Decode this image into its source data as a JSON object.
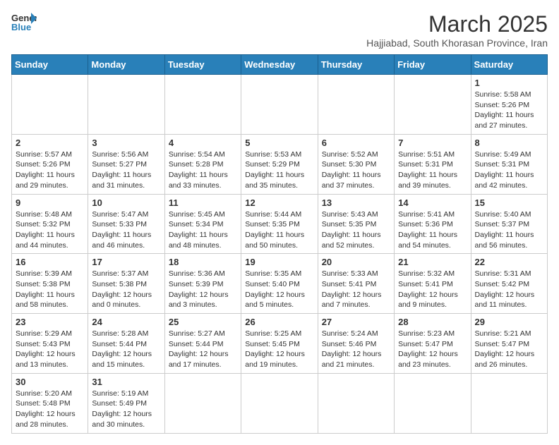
{
  "logo": {
    "text_general": "General",
    "text_blue": "Blue"
  },
  "title": "March 2025",
  "location": "Hajjiabad, South Khorasan Province, Iran",
  "days_of_week": [
    "Sunday",
    "Monday",
    "Tuesday",
    "Wednesday",
    "Thursday",
    "Friday",
    "Saturday"
  ],
  "weeks": [
    [
      {
        "day": "",
        "info": ""
      },
      {
        "day": "",
        "info": ""
      },
      {
        "day": "",
        "info": ""
      },
      {
        "day": "",
        "info": ""
      },
      {
        "day": "",
        "info": ""
      },
      {
        "day": "",
        "info": ""
      },
      {
        "day": "1",
        "info": "Sunrise: 5:58 AM\nSunset: 5:26 PM\nDaylight: 11 hours and 27 minutes."
      }
    ],
    [
      {
        "day": "2",
        "info": "Sunrise: 5:57 AM\nSunset: 5:26 PM\nDaylight: 11 hours and 29 minutes."
      },
      {
        "day": "3",
        "info": "Sunrise: 5:56 AM\nSunset: 5:27 PM\nDaylight: 11 hours and 31 minutes."
      },
      {
        "day": "4",
        "info": "Sunrise: 5:54 AM\nSunset: 5:28 PM\nDaylight: 11 hours and 33 minutes."
      },
      {
        "day": "5",
        "info": "Sunrise: 5:53 AM\nSunset: 5:29 PM\nDaylight: 11 hours and 35 minutes."
      },
      {
        "day": "6",
        "info": "Sunrise: 5:52 AM\nSunset: 5:30 PM\nDaylight: 11 hours and 37 minutes."
      },
      {
        "day": "7",
        "info": "Sunrise: 5:51 AM\nSunset: 5:31 PM\nDaylight: 11 hours and 39 minutes."
      },
      {
        "day": "8",
        "info": "Sunrise: 5:49 AM\nSunset: 5:31 PM\nDaylight: 11 hours and 42 minutes."
      }
    ],
    [
      {
        "day": "9",
        "info": "Sunrise: 5:48 AM\nSunset: 5:32 PM\nDaylight: 11 hours and 44 minutes."
      },
      {
        "day": "10",
        "info": "Sunrise: 5:47 AM\nSunset: 5:33 PM\nDaylight: 11 hours and 46 minutes."
      },
      {
        "day": "11",
        "info": "Sunrise: 5:45 AM\nSunset: 5:34 PM\nDaylight: 11 hours and 48 minutes."
      },
      {
        "day": "12",
        "info": "Sunrise: 5:44 AM\nSunset: 5:35 PM\nDaylight: 11 hours and 50 minutes."
      },
      {
        "day": "13",
        "info": "Sunrise: 5:43 AM\nSunset: 5:35 PM\nDaylight: 11 hours and 52 minutes."
      },
      {
        "day": "14",
        "info": "Sunrise: 5:41 AM\nSunset: 5:36 PM\nDaylight: 11 hours and 54 minutes."
      },
      {
        "day": "15",
        "info": "Sunrise: 5:40 AM\nSunset: 5:37 PM\nDaylight: 11 hours and 56 minutes."
      }
    ],
    [
      {
        "day": "16",
        "info": "Sunrise: 5:39 AM\nSunset: 5:38 PM\nDaylight: 11 hours and 58 minutes."
      },
      {
        "day": "17",
        "info": "Sunrise: 5:37 AM\nSunset: 5:38 PM\nDaylight: 12 hours and 0 minutes."
      },
      {
        "day": "18",
        "info": "Sunrise: 5:36 AM\nSunset: 5:39 PM\nDaylight: 12 hours and 3 minutes."
      },
      {
        "day": "19",
        "info": "Sunrise: 5:35 AM\nSunset: 5:40 PM\nDaylight: 12 hours and 5 minutes."
      },
      {
        "day": "20",
        "info": "Sunrise: 5:33 AM\nSunset: 5:41 PM\nDaylight: 12 hours and 7 minutes."
      },
      {
        "day": "21",
        "info": "Sunrise: 5:32 AM\nSunset: 5:41 PM\nDaylight: 12 hours and 9 minutes."
      },
      {
        "day": "22",
        "info": "Sunrise: 5:31 AM\nSunset: 5:42 PM\nDaylight: 12 hours and 11 minutes."
      }
    ],
    [
      {
        "day": "23",
        "info": "Sunrise: 5:29 AM\nSunset: 5:43 PM\nDaylight: 12 hours and 13 minutes."
      },
      {
        "day": "24",
        "info": "Sunrise: 5:28 AM\nSunset: 5:44 PM\nDaylight: 12 hours and 15 minutes."
      },
      {
        "day": "25",
        "info": "Sunrise: 5:27 AM\nSunset: 5:44 PM\nDaylight: 12 hours and 17 minutes."
      },
      {
        "day": "26",
        "info": "Sunrise: 5:25 AM\nSunset: 5:45 PM\nDaylight: 12 hours and 19 minutes."
      },
      {
        "day": "27",
        "info": "Sunrise: 5:24 AM\nSunset: 5:46 PM\nDaylight: 12 hours and 21 minutes."
      },
      {
        "day": "28",
        "info": "Sunrise: 5:23 AM\nSunset: 5:47 PM\nDaylight: 12 hours and 23 minutes."
      },
      {
        "day": "29",
        "info": "Sunrise: 5:21 AM\nSunset: 5:47 PM\nDaylight: 12 hours and 26 minutes."
      }
    ],
    [
      {
        "day": "30",
        "info": "Sunrise: 5:20 AM\nSunset: 5:48 PM\nDaylight: 12 hours and 28 minutes."
      },
      {
        "day": "31",
        "info": "Sunrise: 5:19 AM\nSunset: 5:49 PM\nDaylight: 12 hours and 30 minutes."
      },
      {
        "day": "",
        "info": ""
      },
      {
        "day": "",
        "info": ""
      },
      {
        "day": "",
        "info": ""
      },
      {
        "day": "",
        "info": ""
      },
      {
        "day": "",
        "info": ""
      }
    ]
  ]
}
